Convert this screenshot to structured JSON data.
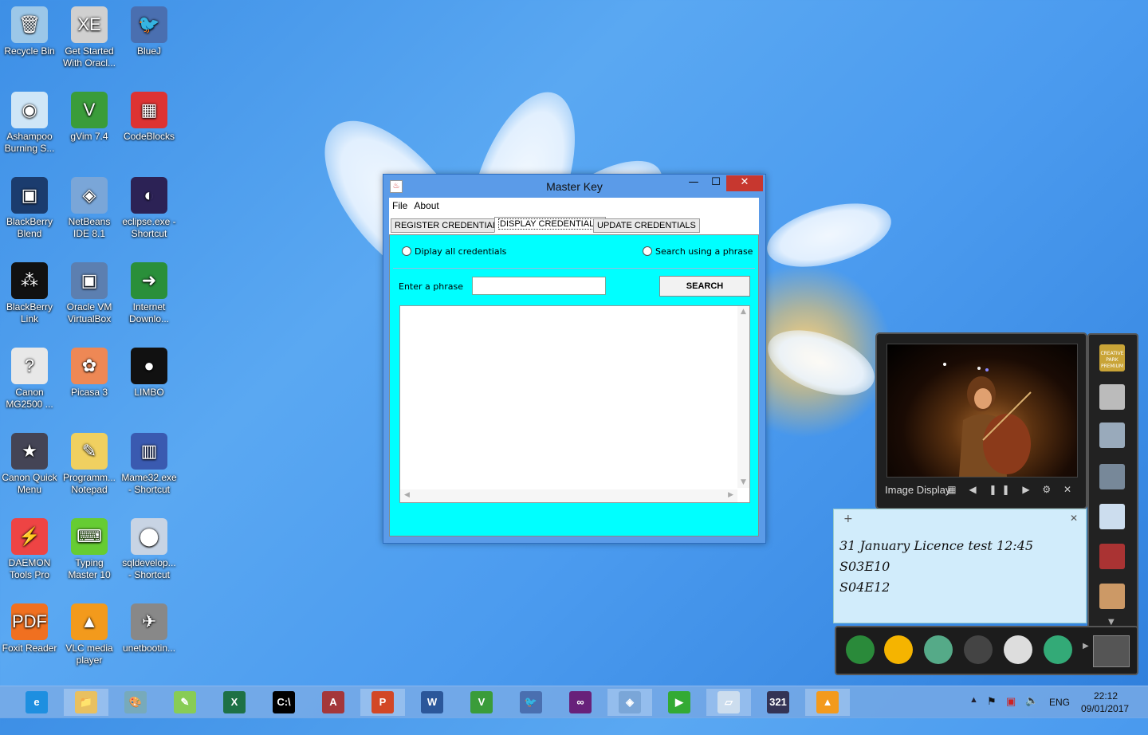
{
  "desktop": {
    "icons": [
      {
        "label": "Recycle Bin",
        "color": "#9cc7e8",
        "glyph": "🗑"
      },
      {
        "label": "Get Started With Oracl...",
        "color": "#d0d0d0",
        "glyph": "XE"
      },
      {
        "label": "BlueJ",
        "color": "#4a6fb0",
        "glyph": "🐦"
      },
      {
        "label": "Ashampoo Burning S...",
        "color": "#cfe6f7",
        "glyph": "◉"
      },
      {
        "label": "gVim 7.4",
        "color": "#3a9c3a",
        "glyph": "V"
      },
      {
        "label": "CodeBlocks",
        "color": "#d33",
        "glyph": "▦"
      },
      {
        "label": "BlackBerry Blend",
        "color": "#1b3c6e",
        "glyph": "▣"
      },
      {
        "label": "NetBeans IDE 8.1",
        "color": "#7aa6d8",
        "glyph": "◈"
      },
      {
        "label": "eclipse.exe - Shortcut",
        "color": "#2c2255",
        "glyph": "◐"
      },
      {
        "label": "BlackBerry Link",
        "color": "#111",
        "glyph": "⁂"
      },
      {
        "label": "Oracle VM VirtualBox",
        "color": "#5c7fb0",
        "glyph": "▣"
      },
      {
        "label": "Internet Downlo...",
        "color": "#2a8f3a",
        "glyph": "➜"
      },
      {
        "label": "Canon MG2500 ...",
        "color": "#e8e8e8",
        "glyph": "?"
      },
      {
        "label": "Picasa 3",
        "color": "#e85",
        "glyph": "✿"
      },
      {
        "label": "LIMBO",
        "color": "#111",
        "glyph": "●"
      },
      {
        "label": "Canon Quick Menu",
        "color": "#445",
        "glyph": "★"
      },
      {
        "label": "Programm... Notepad",
        "color": "#f0d060",
        "glyph": "✎"
      },
      {
        "label": "Mame32.exe - Shortcut",
        "color": "#3a5ab0",
        "glyph": "▥"
      },
      {
        "label": "DAEMON Tools Pro",
        "color": "#e44",
        "glyph": "⚡"
      },
      {
        "label": "Typing Master 10",
        "color": "#6c3",
        "glyph": "⌨"
      },
      {
        "label": "sqldevelop... - Shortcut",
        "color": "#c8d4e4",
        "glyph": "⬤"
      },
      {
        "label": "Foxit Reader",
        "color": "#f07020",
        "glyph": "PDF"
      },
      {
        "label": "VLC media player",
        "color": "#f39a1c",
        "glyph": "▲"
      },
      {
        "label": "unetbootin...",
        "color": "#888",
        "glyph": "✈"
      }
    ]
  },
  "window": {
    "title": "Master Key",
    "controls": {
      "minimize": "—",
      "maximize": "☐",
      "close": "✕"
    },
    "menu": [
      "File",
      "About"
    ],
    "tabs": [
      "REGISTER CREDENTIALS",
      "DISPLAY CREDENTIALS",
      "UPDATE CREDENTIALS"
    ],
    "active_tab": "DISPLAY CREDENTIALS",
    "radio_all": "Diplay all credentials",
    "radio_search": "Search using a phrase",
    "phrase_label": "Enter a phrase",
    "phrase_value": "",
    "search_button": "SEARCH",
    "results_text": ""
  },
  "gadgets": {
    "image_display": {
      "caption": "Image Display",
      "controls": "▦ ◀ ❚❚ ▶ ⚙ ✕"
    },
    "sticky_note": {
      "lines": [
        "31 January Licence test 12:45",
        "S03E10",
        "S04E12"
      ]
    },
    "sidebar_badge": "CREATIVE PARK PREMIUM"
  },
  "taskbar": {
    "apps": [
      {
        "name": "internet-explorer",
        "glyph": "e",
        "color": "#1e8fe0"
      },
      {
        "name": "file-explorer",
        "glyph": "📁",
        "color": "#e8c060"
      },
      {
        "name": "paint",
        "glyph": "🎨",
        "color": "#7ab"
      },
      {
        "name": "notepad-plus",
        "glyph": "✎",
        "color": "#8c5"
      },
      {
        "name": "excel",
        "glyph": "X",
        "color": "#1e7145"
      },
      {
        "name": "command-prompt",
        "glyph": "C:\\",
        "color": "#000"
      },
      {
        "name": "access",
        "glyph": "A",
        "color": "#a4373a"
      },
      {
        "name": "powerpoint",
        "glyph": "P",
        "color": "#d24726"
      },
      {
        "name": "word",
        "glyph": "W",
        "color": "#2b579a"
      },
      {
        "name": "gvim",
        "glyph": "V",
        "color": "#3a9c3a"
      },
      {
        "name": "bluej",
        "glyph": "🐦",
        "color": "#4a6fb0"
      },
      {
        "name": "visual-studio",
        "glyph": "∞",
        "color": "#68217a"
      },
      {
        "name": "netbeans",
        "glyph": "◈",
        "color": "#7aa6d8"
      },
      {
        "name": "media-task",
        "glyph": "▶",
        "color": "#3a3"
      },
      {
        "name": "sticky-notes",
        "glyph": "▱",
        "color": "#cde"
      },
      {
        "name": "media-player-321",
        "glyph": "321",
        "color": "#335"
      },
      {
        "name": "vlc",
        "glyph": "▲",
        "color": "#f39a1c"
      }
    ],
    "language": "ENG",
    "time": "22:12",
    "date": "09/01/2017"
  }
}
